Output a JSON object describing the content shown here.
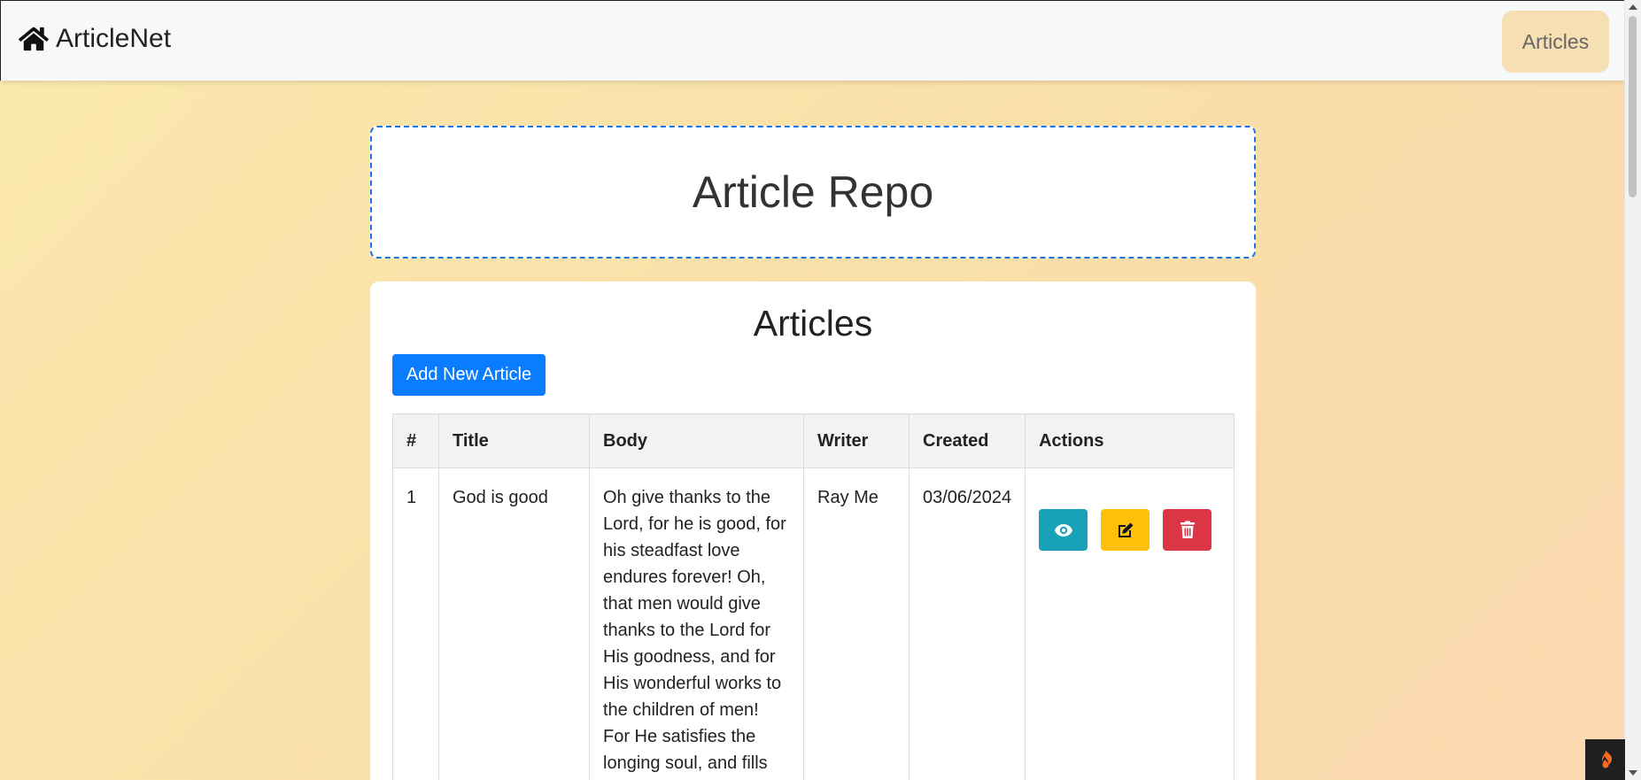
{
  "navbar": {
    "brand": "ArticleNet",
    "brand_icon": "home-icon",
    "link_articles": "Articles"
  },
  "header": {
    "title": "Article Repo"
  },
  "articles": {
    "heading": "Articles",
    "add_button": "Add New Article",
    "columns": [
      "#",
      "Title",
      "Body",
      "Writer",
      "Created",
      "Actions"
    ],
    "rows": [
      {
        "num": "1",
        "title": "God is good",
        "body": "Oh give thanks to the Lord, for he is good, for his steadfast love endures forever! Oh, that men would give thanks to the Lord for His goodness, and for His wonderful works to the children of men! For He satisfies the longing soul, and fills the",
        "writer": "Ray Me",
        "created": "03/06/2024",
        "actions": [
          "eye-icon",
          "edit-icon",
          "trash-icon"
        ]
      }
    ]
  },
  "colors": {
    "primary": "#0a7cff",
    "info": "#17a2b8",
    "warning": "#ffc107",
    "danger": "#dc3545",
    "header_border": "#1a73e8",
    "nav_link_bg": "#f6dfb2"
  }
}
